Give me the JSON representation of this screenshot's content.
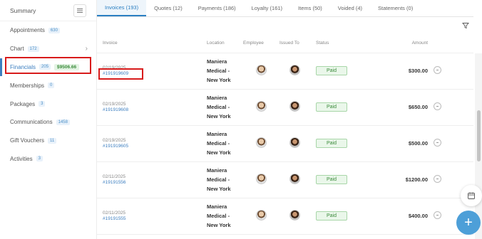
{
  "sidebar": {
    "title": "Summary",
    "items": [
      {
        "label": "Appointments",
        "count": "630"
      },
      {
        "label": "Chart",
        "count": "172"
      },
      {
        "label": "Financials",
        "count": "205",
        "amount": "$9506.66"
      },
      {
        "label": "Memberships",
        "count": "0"
      },
      {
        "label": "Packages",
        "count": "3"
      },
      {
        "label": "Communications",
        "count": "1458"
      },
      {
        "label": "Gift Vouchers",
        "count": "11"
      },
      {
        "label": "Activities",
        "count": "3"
      }
    ]
  },
  "tabs": [
    {
      "label": "Invoices (193)"
    },
    {
      "label": "Quotes (12)"
    },
    {
      "label": "Payments (186)"
    },
    {
      "label": "Loyalty (161)"
    },
    {
      "label": "Items (50)"
    },
    {
      "label": "Voided (4)"
    },
    {
      "label": "Statements (0)"
    }
  ],
  "table": {
    "headers": {
      "invoice": "Invoice",
      "location": "Location",
      "employee": "Employee",
      "issued_to": "Issued To",
      "status": "Status",
      "amount": "Amount"
    },
    "rows": [
      {
        "date": "02/19/2025",
        "number": "#191919609",
        "location_line1": "Maniera",
        "location_line2": "Medical -",
        "location_line3": "New York",
        "status": "Paid",
        "amount": "$300.00"
      },
      {
        "date": "02/19/2025",
        "number": "#191919608",
        "location_line1": "Maniera",
        "location_line2": "Medical -",
        "location_line3": "New York",
        "status": "Paid",
        "amount": "$650.00"
      },
      {
        "date": "02/19/2025",
        "number": "#191919605",
        "location_line1": "Maniera",
        "location_line2": "Medical -",
        "location_line3": "New York",
        "status": "Paid",
        "amount": "$500.00"
      },
      {
        "date": "02/11/2025",
        "number": "#19191556",
        "location_line1": "Maniera",
        "location_line2": "Medical -",
        "location_line3": "New York",
        "status": "Paid",
        "amount": "$1200.00"
      },
      {
        "date": "02/11/2025",
        "number": "#19191555",
        "location_line1": "Maniera",
        "location_line2": "Medical -",
        "location_line3": "New York",
        "status": "Paid",
        "amount": "$400.00"
      }
    ]
  },
  "icons": {
    "menu": "menu-icon",
    "filter": "filter-icon",
    "calendar": "calendar-icon",
    "add": "plus-icon",
    "chevron": "chevron-right-icon"
  },
  "colors": {
    "accent": "#2a7fc2",
    "paid_green": "#3a8a3a",
    "highlight_red": "#d81b1b",
    "fab_blue": "#4d9fd8"
  }
}
